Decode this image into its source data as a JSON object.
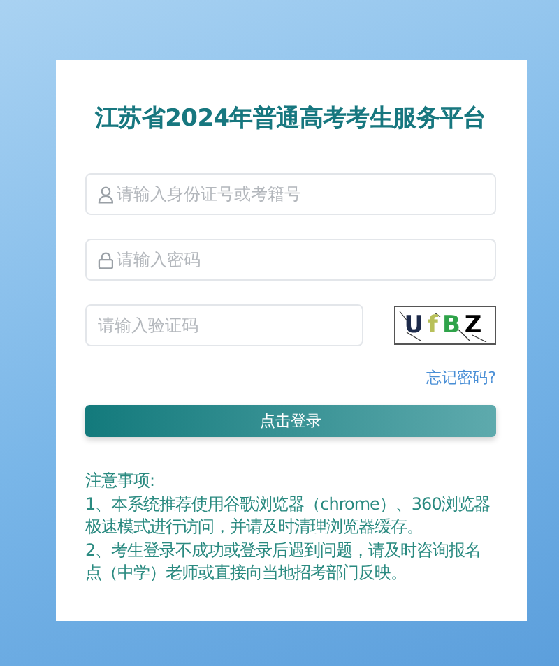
{
  "title": "江苏省2024年普通高考考生服务平台",
  "fields": [
    {
      "kind": "user",
      "placeholder": "请输入身份证号或考籍号"
    },
    {
      "kind": "lock",
      "placeholder": "请输入密码"
    },
    {
      "kind": "captcha",
      "placeholder": "请输入验证码"
    }
  ],
  "captcha": "UfBZ",
  "forgot_link": "忘记密码?",
  "login_button": "点击登录",
  "notes": {
    "heading": "注意事项:",
    "items": [
      "1、本系统推荐使用谷歌浏览器（chrome）、360浏览器极速模式进行访问，并请及时清理浏览器缓存。",
      "2、考生登录不成功或登录后遇到问题，请及时咨询报名点（中学）老师或直接向当地招考部门反映。"
    ]
  }
}
